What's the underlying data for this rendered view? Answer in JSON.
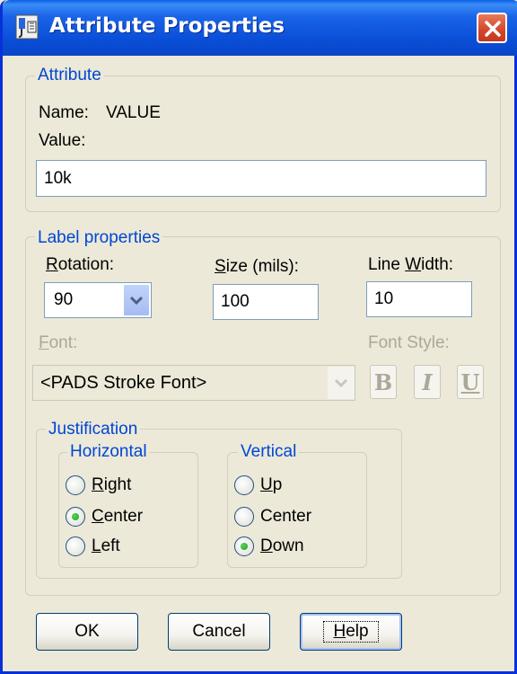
{
  "window": {
    "title": "Attribute Properties"
  },
  "attribute": {
    "legend": "Attribute",
    "name_label": "Name:",
    "name_value": "VALUE",
    "value_label": "Value:",
    "value_input": "10k"
  },
  "label_properties": {
    "legend": "Label properties",
    "rotation_label": "Rotation:",
    "rotation_value": "90",
    "size_label": "Size (mils):",
    "size_value": "100",
    "line_width_label": "Line Width:",
    "line_width_value": "10",
    "font_label": "Font:",
    "font_value": "<PADS Stroke Font>",
    "font_style_label": "Font Style:",
    "bold_label": "B",
    "italic_label": "I",
    "underline_label": "U"
  },
  "justification": {
    "legend": "Justification",
    "horizontal": {
      "legend": "Horizontal",
      "options": [
        "Right",
        "Center",
        "Left"
      ],
      "selected": "Center"
    },
    "vertical": {
      "legend": "Vertical",
      "options": [
        "Up",
        "Center",
        "Down"
      ],
      "selected": "Down"
    }
  },
  "buttons": {
    "ok": "OK",
    "cancel": "Cancel",
    "help": "Help"
  },
  "colors": {
    "title_bar": "#0a4fd8",
    "group_legend": "#0046d5",
    "close_button": "#d4452a",
    "radio_selected": "#21a121"
  }
}
